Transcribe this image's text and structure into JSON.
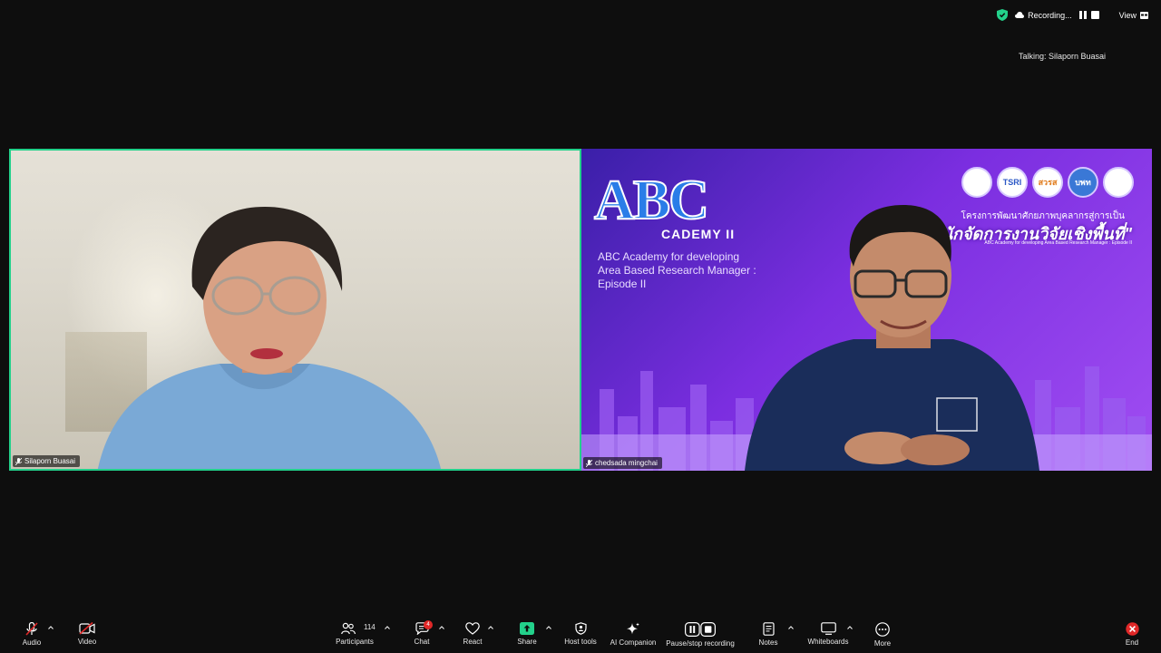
{
  "topbar": {
    "recording_label": "Recording...",
    "view_label": "View"
  },
  "talking_label": "Talking: Silaporn Buasai",
  "tiles": [
    {
      "name": "Silaporn Buasai"
    },
    {
      "name": "chedsada mingchai"
    }
  ],
  "slide": {
    "title": "ABC",
    "subtitle": "CADEMY II",
    "description_lines": [
      "ABC Academy for developing",
      "Area Based Research Manager :",
      "Episode II"
    ],
    "logos": [
      "",
      "TSRI",
      "สวรส",
      "บพท",
      ""
    ],
    "thai_small": "โครงการพัฒนาศักยภาพบุคลากรสู่การเป็น",
    "thai_big": "\"นักจัดการงานวิจัยเชิงพื้นที่\"",
    "thai_en": "ABC Academy for developing Area Based Research Manager : Episode II"
  },
  "toolbar": {
    "left": [
      {
        "label": "Audio",
        "icon": "mic-muted-icon"
      },
      {
        "label": "Video",
        "icon": "video-off-icon"
      }
    ],
    "center": [
      {
        "label": "Participants",
        "icon": "participants-icon",
        "count": "114"
      },
      {
        "label": "Chat",
        "icon": "chat-icon",
        "badge": "4"
      },
      {
        "label": "React",
        "icon": "heart-icon"
      },
      {
        "label": "Share",
        "icon": "share-icon"
      },
      {
        "label": "Host tools",
        "icon": "shield-icon"
      },
      {
        "label": "AI Companion",
        "icon": "sparkle-icon"
      },
      {
        "label": "Pause/stop recording",
        "icon": "pause-stop-icon"
      },
      {
        "label": "Notes",
        "icon": "notes-icon"
      },
      {
        "label": "Whiteboards",
        "icon": "whiteboard-icon"
      },
      {
        "label": "More",
        "icon": "more-icon"
      }
    ],
    "right": [
      {
        "label": "End",
        "icon": "end-icon"
      }
    ]
  },
  "colors": {
    "active_speaker_border": "#23d18b",
    "share_green": "#23d18b",
    "end_red": "#e02828",
    "badge_red": "#e02828",
    "slide_purple": "#7b2ee0"
  }
}
